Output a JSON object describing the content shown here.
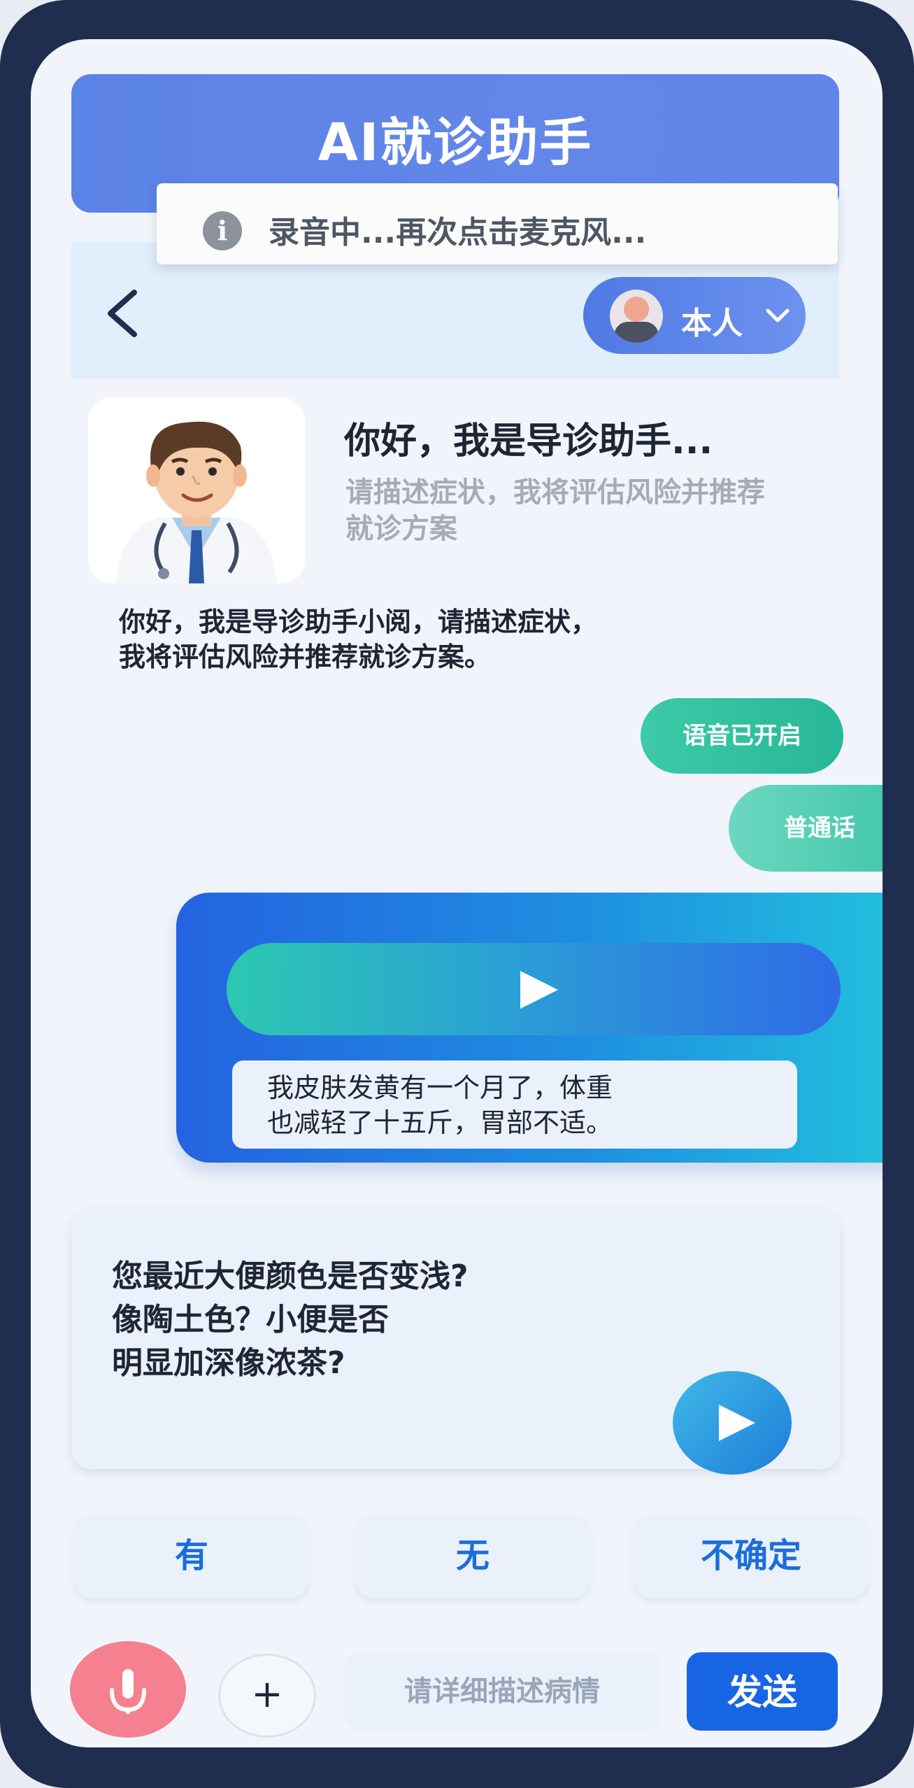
{
  "app": {
    "title": "AI就诊助手"
  },
  "toast": {
    "text": "录音中...再次点击麦克风..."
  },
  "nav": {
    "user_label": "本人"
  },
  "assistant": {
    "greeting_title": "你好，我是导诊助手...",
    "greeting_subtitle": "请描述症状，我将评估风险并推荐就诊方案",
    "intro_line1": "你好，我是导诊助手小阅，请描述症状，",
    "intro_line2": "我将评估风险并推荐就诊方案。"
  },
  "chips": {
    "voice_on": "语音已开启",
    "language": "普通话"
  },
  "user_voice": {
    "transcript_line1": "我皮肤发黄有一个月了，体重",
    "transcript_line2": "也减轻了十五斤，胃部不适。"
  },
  "question": {
    "line1": "您最近大便颜色是否变浅?",
    "line2": "像陶土色？小便是否",
    "line3": "明显加深像浓茶?"
  },
  "options": [
    "有",
    "无",
    "不确定"
  ],
  "composer": {
    "placeholder": "请详细描述病情",
    "send_label": "发送",
    "plus_label": "+"
  },
  "colors": {
    "primary": "#1865e3",
    "accent_green": "#2fbf9f",
    "mic": "#f5808f",
    "frame": "#1f2d4f"
  },
  "icons": {
    "info": "info-icon",
    "back": "chevron-left-icon",
    "dropdown": "chevron-down-icon",
    "play": "play-icon",
    "mic": "microphone-icon"
  }
}
